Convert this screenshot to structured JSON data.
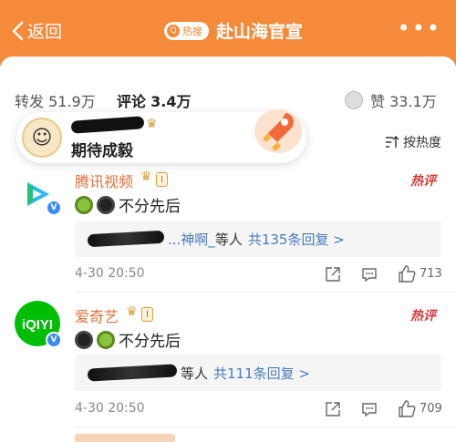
{
  "header": {
    "back_label": "返回",
    "hot_badge": "热搜",
    "title": "赴山海官宣",
    "more_label": "•••"
  },
  "stats": {
    "repost_label": "转发",
    "repost_count": "51.9万",
    "comment_label": "评论",
    "comment_count": "3.4万",
    "like_label": "赞",
    "like_count": "33.1万"
  },
  "popup": {
    "text": "期待成毅"
  },
  "sort": {
    "label": "按热度"
  },
  "comments": [
    {
      "name": "腾讯视频",
      "level": "I",
      "hot": "热评",
      "text": "不分先后",
      "reply_name": "...神啊_",
      "reply_etc": "等人",
      "reply_link": "共135条回复 >",
      "time": "4-30 20:50",
      "likes": "713"
    },
    {
      "name": "爱奇艺",
      "level": "I",
      "hot": "热评",
      "text": "不分先后",
      "reply_name": "",
      "reply_etc": "等人",
      "reply_link": "共111条回复 >",
      "time": "4-30 20:50",
      "likes": "709"
    }
  ],
  "colors": {
    "header_orange": "#f58a3a",
    "name_orange": "#e0713a",
    "link_blue": "#4a7bbf",
    "hot_red": "#d53c3c"
  },
  "icons": {
    "back": "chevron-left-icon",
    "sort": "sort-icon",
    "share": "share-icon",
    "comment": "comment-icon",
    "like": "thumb-up-icon"
  }
}
